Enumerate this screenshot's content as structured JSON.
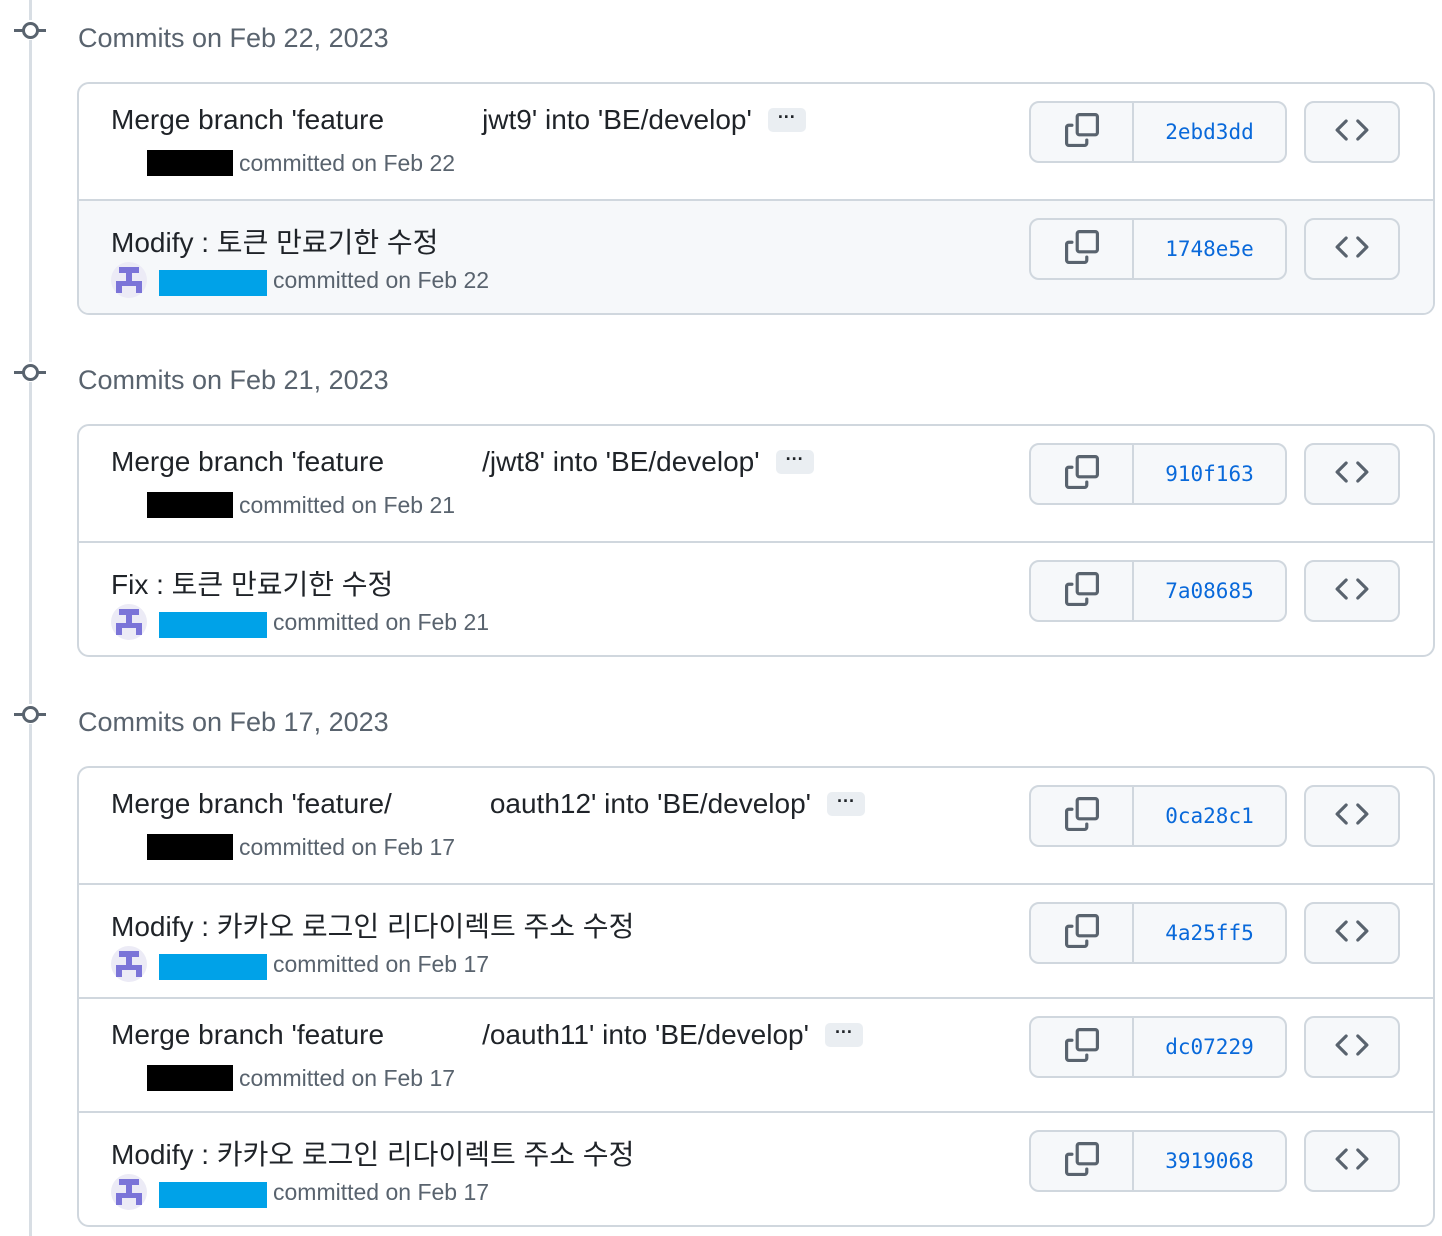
{
  "groups": [
    {
      "title": "Commits on Feb 22, 2023",
      "commits": [
        {
          "msg_a": "Merge branch 'feature",
          "msg_b": "jwt9' into 'BE/develop'",
          "gap": 98,
          "has_ellipsis": true,
          "ellipsis": "···",
          "author_redaction": "black",
          "meta": "committed on Feb 22",
          "sha": "2ebd3dd",
          "highlight": false
        },
        {
          "msg_a": "Modify : 토큰 만료기한 수정",
          "msg_b": "",
          "gap": 0,
          "has_ellipsis": false,
          "ellipsis": "",
          "author_redaction": "avatar",
          "meta": "committed on Feb 22",
          "sha": "1748e5e",
          "highlight": true
        }
      ]
    },
    {
      "title": "Commits on Feb 21, 2023",
      "commits": [
        {
          "msg_a": "Merge branch 'feature",
          "msg_b": "/jwt8' into 'BE/develop'",
          "gap": 98,
          "has_ellipsis": true,
          "ellipsis": "···",
          "author_redaction": "black",
          "meta": "committed on Feb 21",
          "sha": "910f163",
          "highlight": false
        },
        {
          "msg_a": "Fix : 토큰 만료기한 수정",
          "msg_b": "",
          "gap": 0,
          "has_ellipsis": false,
          "ellipsis": "",
          "author_redaction": "avatar",
          "meta": "committed on Feb 21",
          "sha": "7a08685",
          "highlight": false
        }
      ]
    },
    {
      "title": "Commits on Feb 17, 2023",
      "commits": [
        {
          "msg_a": "Merge branch 'feature/",
          "msg_b": "oauth12' into 'BE/develop'",
          "gap": 98,
          "has_ellipsis": true,
          "ellipsis": "···",
          "author_redaction": "black",
          "meta": "committed on Feb 17",
          "sha": "0ca28c1",
          "highlight": false
        },
        {
          "msg_a": "Modify : 카카오 로그인 리다이렉트 주소 수정",
          "msg_b": "",
          "gap": 0,
          "has_ellipsis": false,
          "ellipsis": "",
          "author_redaction": "avatar",
          "meta": "committed on Feb 17",
          "sha": "4a25ff5",
          "highlight": false
        },
        {
          "msg_a": "Merge branch 'feature",
          "msg_b": "/oauth11' into 'BE/develop'",
          "gap": 98,
          "has_ellipsis": true,
          "ellipsis": "···",
          "author_redaction": "black",
          "meta": "committed on Feb 17",
          "sha": "dc07229",
          "highlight": false
        },
        {
          "msg_a": "Modify : 카카오 로그인 리다이렉트 주소 수정",
          "msg_b": "",
          "gap": 0,
          "has_ellipsis": false,
          "ellipsis": "",
          "author_redaction": "avatar",
          "meta": "committed on Feb 17",
          "sha": "3919068",
          "highlight": false
        }
      ]
    }
  ]
}
